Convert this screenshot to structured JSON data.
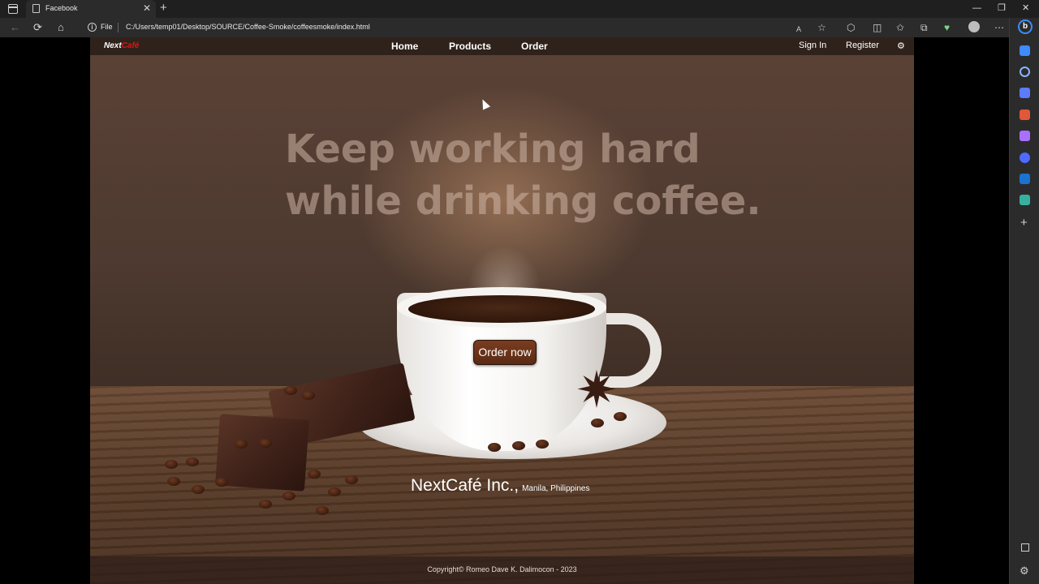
{
  "browser": {
    "tab_title": "Facebook",
    "tab_close": "✕",
    "new_tab": "+",
    "address_scheme": "File",
    "url": "C:/Users/temp01/Desktop/SOURCE/Coffee-Smoke/coffeesmoke/index.html",
    "window_controls": [
      "—",
      "❐",
      "✕"
    ]
  },
  "site": {
    "logo_part1": "Next",
    "logo_part2": "Café",
    "brand_colors": {
      "logo_main": "#ffffff",
      "logo_accent": "#d61818",
      "button": "#6a321a"
    },
    "nav": [
      "Home",
      "Products",
      "Order"
    ],
    "auth": [
      "Sign In",
      "Register"
    ],
    "headline_line1": "Keep working hard",
    "headline_line2": "while drinking coffee.",
    "cta": "Order now",
    "company_name": "NextCafé Inc.,",
    "company_location": "Manila, Philippines",
    "copyright": "Copyright© Romeo Dave K. Dalimocon - 2023"
  }
}
